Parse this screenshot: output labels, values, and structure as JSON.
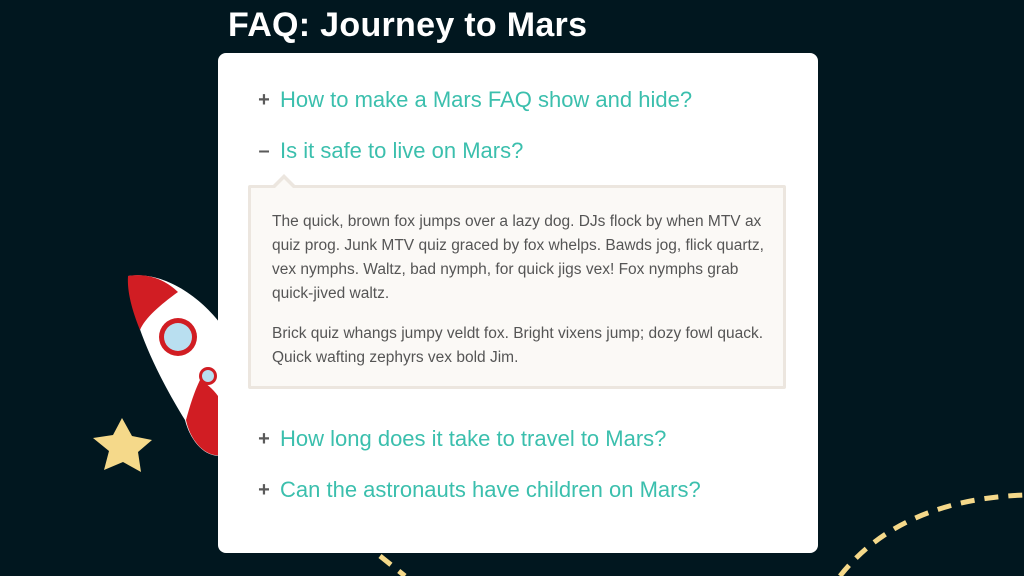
{
  "page": {
    "title": "FAQ: Journey to Mars"
  },
  "faq": {
    "items": [
      {
        "toggle": "+",
        "question": "How to make a Mars FAQ show and hide?",
        "expanded": false
      },
      {
        "toggle": "–",
        "question": "Is it safe to live on Mars?",
        "expanded": true,
        "answer": [
          "The quick, brown fox jumps over a lazy dog. DJs flock by when MTV ax quiz prog. Junk MTV quiz graced by fox whelps. Bawds jog, flick quartz, vex nymphs. Waltz, bad nymph, for quick jigs vex! Fox nymphs grab quick-jived waltz.",
          "Brick quiz whangs jumpy veldt fox. Bright vixens jump; dozy fowl quack. Quick wafting zephyrs vex bold Jim."
        ]
      },
      {
        "toggle": "+",
        "question": "How long does it take to travel to Mars?",
        "expanded": false
      },
      {
        "toggle": "+",
        "question": "Can the astronauts have children on Mars?",
        "expanded": false
      }
    ]
  },
  "colors": {
    "background": "#01171f",
    "accent": "#3bbfad",
    "rocket_red": "#d11d23",
    "star": "#f5d98a",
    "dash_path": "#f5d98a"
  }
}
